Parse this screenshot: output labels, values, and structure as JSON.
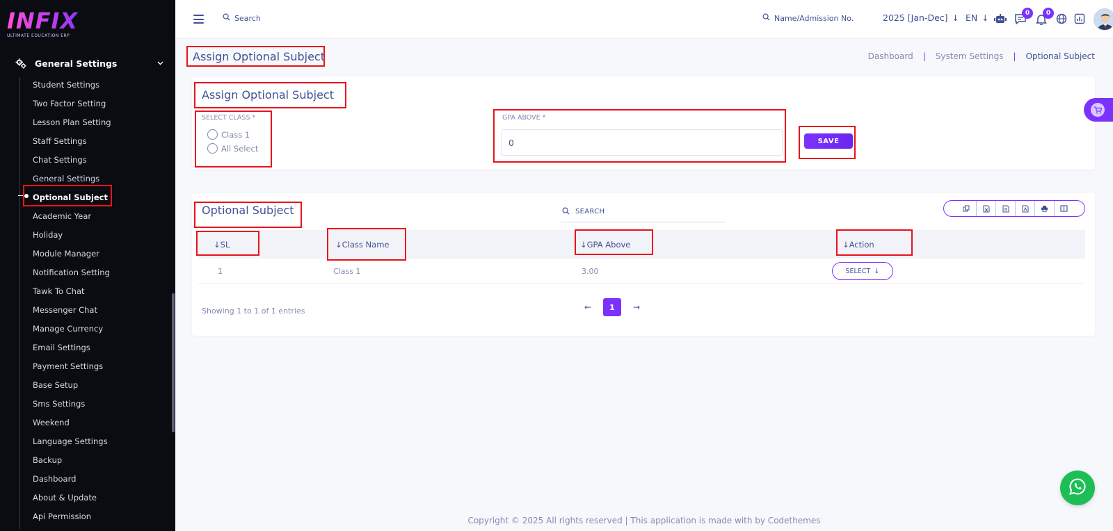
{
  "brand": {
    "name": "INFIX",
    "tagline": "ULTIMATE EDUCATION ERP"
  },
  "sidebar": {
    "section_title": "General Settings",
    "items": [
      {
        "label": "Student Settings"
      },
      {
        "label": "Two Factor Setting"
      },
      {
        "label": "Lesson Plan Setting"
      },
      {
        "label": "Staff Settings"
      },
      {
        "label": "Chat Settings"
      },
      {
        "label": "General Settings"
      },
      {
        "label": "Optional Subject",
        "active": true
      },
      {
        "label": "Academic Year"
      },
      {
        "label": "Holiday"
      },
      {
        "label": "Module Manager"
      },
      {
        "label": "Notification Setting"
      },
      {
        "label": "Tawk To Chat"
      },
      {
        "label": "Messenger Chat"
      },
      {
        "label": "Manage Currency"
      },
      {
        "label": "Email Settings"
      },
      {
        "label": "Payment Settings"
      },
      {
        "label": "Base Setup"
      },
      {
        "label": "Sms Settings"
      },
      {
        "label": "Weekend"
      },
      {
        "label": "Language Settings"
      },
      {
        "label": "Backup"
      },
      {
        "label": "Dashboard"
      },
      {
        "label": "About & Update"
      },
      {
        "label": "Api Permission"
      }
    ]
  },
  "topbar": {
    "search_label": "Search",
    "name_search_label": "Name/Admission No.",
    "academic_year": "2025 [Jan-Dec]",
    "language": "EN",
    "chat_badge": "0",
    "notification_badge": "0"
  },
  "page": {
    "title": "Assign Optional Subject",
    "breadcrumb": [
      "Dashboard",
      "System Settings",
      "Optional Subject"
    ]
  },
  "assign_form": {
    "title": "Assign Optional Subject",
    "select_class_label": "SELECT CLASS *",
    "class_options": [
      "Class 1",
      "All Select"
    ],
    "gpa_label": "GPA ABOVE *",
    "gpa_value": "0",
    "save_label": "SAVE"
  },
  "table": {
    "title": "Optional Subject",
    "search_label": "SEARCH",
    "columns": [
      "SL",
      "Class Name",
      "GPA Above",
      "Action"
    ],
    "rows": [
      {
        "sl": "1",
        "class_name": "Class 1",
        "gpa": "3.00",
        "action": "SELECT"
      }
    ],
    "showing": "Showing 1 to 1 of 1 entries",
    "current_page": "1"
  },
  "footer": {
    "text": "Copyright © 2025 All rights reserved | This application is made with by Codethemes"
  },
  "colors": {
    "accent": "#7c32ff",
    "text": "#415094",
    "muted": "#828bb2",
    "sidebar_bg": "#0b0b12",
    "highlight": "#e8131b"
  },
  "icons": [
    "hamburger-icon",
    "search-icon",
    "robot-icon",
    "chat-icon",
    "bell-icon",
    "globe-icon",
    "report-icon",
    "cart-icon",
    "whatsapp-icon",
    "gear-icon",
    "copy-icon",
    "excel-icon",
    "csv-icon",
    "pdf-icon",
    "print-icon",
    "columns-icon"
  ]
}
